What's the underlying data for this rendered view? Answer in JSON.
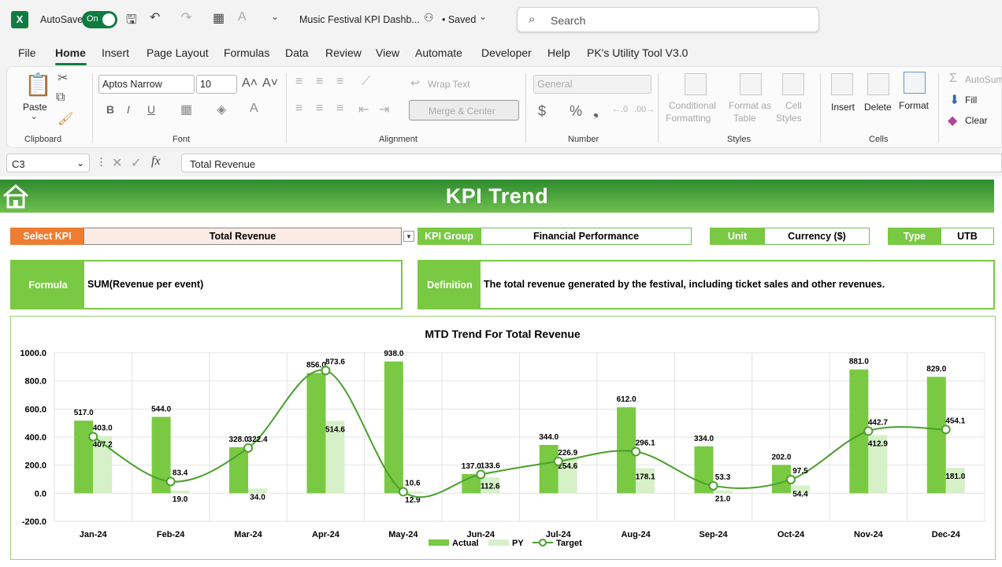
{
  "titlebar": {
    "autosave_label": "AutoSave",
    "toggle_label": "On",
    "file_name": "Music Festival KPI Dashb...",
    "saved_status": "• Saved",
    "search_placeholder": "Search"
  },
  "menu": [
    "File",
    "Home",
    "Insert",
    "Page Layout",
    "Formulas",
    "Data",
    "Review",
    "View",
    "Automate",
    "Developer",
    "Help",
    "PK's Utility Tool V3.0"
  ],
  "ribbon": {
    "clipboard": {
      "paste": "Paste",
      "label": "Clipboard"
    },
    "font": {
      "name": "Aptos Narrow",
      "size": "10",
      "label": "Font",
      "bold": "B",
      "italic": "I",
      "underline": "U"
    },
    "alignment": {
      "wrap": "Wrap Text",
      "merge": "Merge & Center",
      "label": "Alignment"
    },
    "number": {
      "format": "General",
      "label": "Number",
      "currency": "$",
      "percent": "%",
      "comma": "❟"
    },
    "styles": {
      "conditional_1": "Conditional",
      "conditional_2": "Formatting",
      "format_table_1": "Format as",
      "format_table_2": "Table",
      "cell_styles_1": "Cell",
      "cell_styles_2": "Styles",
      "label": "Styles"
    },
    "cells": {
      "insert": "Insert",
      "delete": "Delete",
      "format": "Format",
      "label": "Cells"
    },
    "editing": {
      "autosum": "AutoSum",
      "fill": "Fill",
      "clear": "Clear"
    }
  },
  "formula_bar": {
    "cell_ref": "C3",
    "content": "Total Revenue",
    "fx": "fx"
  },
  "sheet": {
    "banner_title": "KPI Trend",
    "select_kpi_label": "Select KPI",
    "select_kpi_value": "Total Revenue",
    "kpi_group_label": "KPI Group",
    "kpi_group_value": "Financial Performance",
    "unit_label": "Unit",
    "unit_value": "Currency ($)",
    "type_label": "Type",
    "type_value": "UTB",
    "formula_label": "Formula",
    "formula_value": "SUM(Revenue per event)",
    "definition_label": "Definition",
    "definition_value": "The total revenue generated by the festival, including ticket sales and other revenues."
  },
  "colors": {
    "actual": "#7ac943",
    "py": "#d6f0c8",
    "target": "#4aa02c",
    "banner": "#3a9a30",
    "accent_orange": "#ed7d31"
  },
  "chart_data": {
    "type": "bar",
    "title": "MTD Trend For Total Revenue",
    "categories": [
      "Jan-24",
      "Feb-24",
      "Mar-24",
      "Apr-24",
      "May-24",
      "Jun-24",
      "Jul-24",
      "Aug-24",
      "Sep-24",
      "Oct-24",
      "Nov-24",
      "Dec-24"
    ],
    "ylim": [
      -200,
      1000
    ],
    "yticks": [
      "-200.0",
      "0.0",
      "200.0",
      "400.0",
      "600.0",
      "800.0",
      "1000.0"
    ],
    "grid": true,
    "legend": "bottom",
    "series": [
      {
        "name": "Actual",
        "type": "bar",
        "values": [
          517.0,
          544.0,
          328.0,
          856.0,
          938.0,
          137.0,
          344.0,
          612.0,
          334.0,
          202.0,
          881.0,
          829.0
        ]
      },
      {
        "name": "PY",
        "type": "bar",
        "values": [
          407.2,
          19.0,
          34.0,
          514.6,
          12.9,
          112.6,
          254.6,
          178.1,
          21.0,
          54.4,
          412.9,
          181.0
        ]
      },
      {
        "name": "Target",
        "type": "line",
        "values": [
          403.0,
          83.4,
          322.4,
          873.6,
          10.6,
          133.6,
          226.9,
          296.1,
          53.3,
          97.5,
          442.7,
          454.1
        ]
      }
    ]
  }
}
